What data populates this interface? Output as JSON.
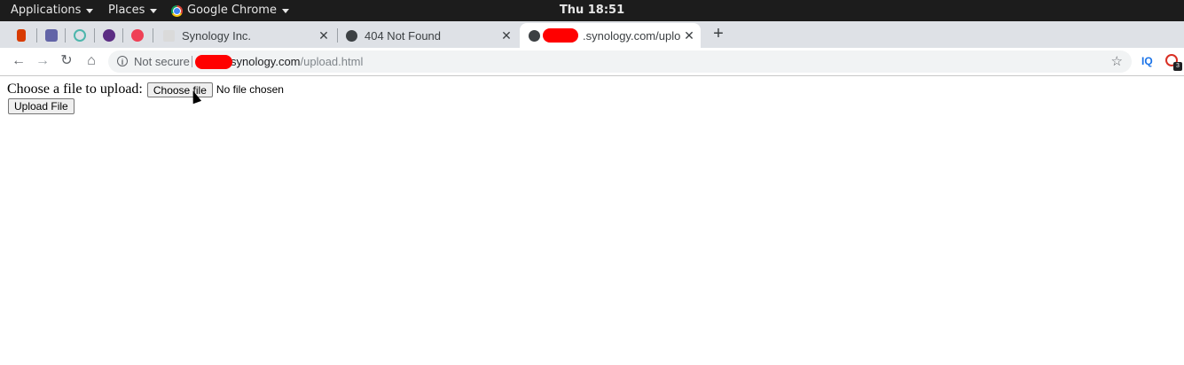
{
  "system_bar": {
    "applications_label": "Applications",
    "places_label": "Places",
    "app_label": "Google Chrome",
    "clock": "Thu 18:51"
  },
  "tabs": [
    {
      "title": "Synology Inc.",
      "active": false
    },
    {
      "title": "404 Not Found",
      "active": false
    },
    {
      "title": ".synology.com/uplo",
      "active": true
    }
  ],
  "toolbar": {
    "security_label": "Not secure",
    "url_domain": "synology.com",
    "url_path": "/upload.html",
    "extension_iq_label": "IQ",
    "extension_badge": "3"
  },
  "page": {
    "file_label": "Choose a file to upload:",
    "choose_button": "Choose file",
    "no_file_text": "No file chosen",
    "upload_button": "Upload File"
  },
  "colors": {
    "tabstrip_bg": "#dee1e6",
    "redaction": "#ff0000",
    "topbar_bg": "#1c1c1c"
  }
}
